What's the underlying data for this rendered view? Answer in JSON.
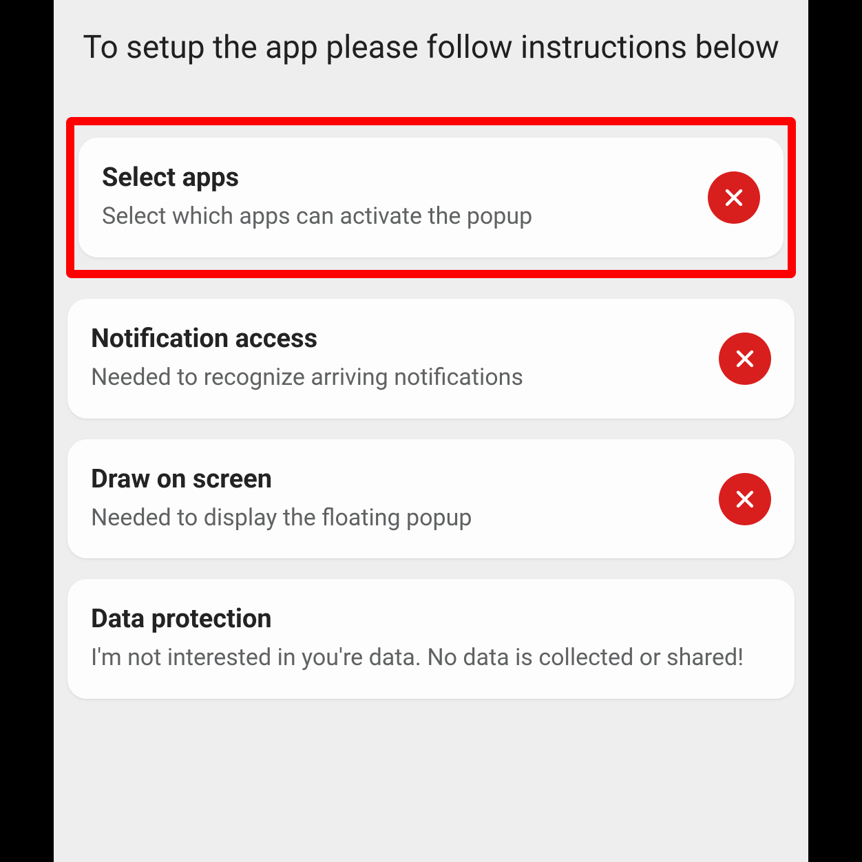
{
  "header": {
    "title": "To setup the app please follow instructions below"
  },
  "cards": [
    {
      "id": "select-apps",
      "title": "Select apps",
      "subtitle": "Select which apps can activate the popup",
      "status": "x",
      "highlighted": true
    },
    {
      "id": "notification-access",
      "title": "Notification access",
      "subtitle": "Needed to recognize arriving notifications",
      "status": "x",
      "highlighted": false
    },
    {
      "id": "draw-on-screen",
      "title": "Draw on screen",
      "subtitle": "Needed to display the floating popup",
      "status": "x",
      "highlighted": false
    },
    {
      "id": "data-protection",
      "title": "Data protection",
      "subtitle": "I'm not interested in you're data. No data is collected or shared!",
      "status": "none",
      "highlighted": false
    }
  ],
  "colors": {
    "badge_bg": "#d91e1e",
    "highlight_border": "#ff0000"
  }
}
